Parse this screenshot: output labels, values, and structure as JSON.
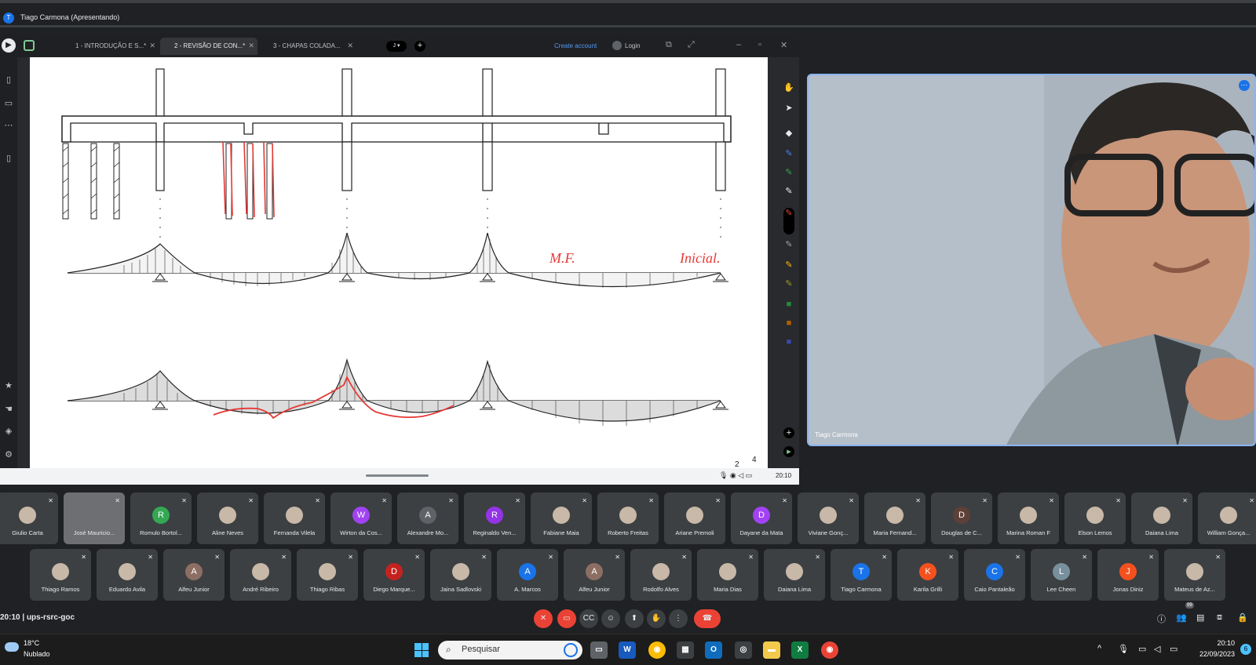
{
  "window": {
    "title": "Tiago Carmona (Apresentando)",
    "initial": "T"
  },
  "presentation": {
    "tabs": [
      {
        "label": "1 - INTRODUÇÃO E S...*",
        "active": false
      },
      {
        "label": "2 - REVISÃO DE CON...*",
        "active": true
      },
      {
        "label": "3 - CHAPAS COLADA...",
        "active": false
      }
    ],
    "pill_label": "J",
    "create_account": "Create account",
    "login": "Login",
    "slide": {
      "annotation_mf": "M.F.",
      "annotation_inicial": "Inicial."
    },
    "page_current": "2",
    "page_total": "4",
    "small_time": "20:10"
  },
  "speaker": {
    "name": "Tiago Carmona"
  },
  "participants_row1": [
    {
      "name": "Giulio Carta",
      "initial": "",
      "color": "#5f6368",
      "photo": true
    },
    {
      "name": "José Mauricio...",
      "initial": "",
      "color": "#5f6368",
      "video": true
    },
    {
      "name": "Romulo Bortol...",
      "initial": "R",
      "color": "#34a853"
    },
    {
      "name": "Aline Neves",
      "initial": "",
      "color": "#c58af9",
      "photo": true
    },
    {
      "name": "Fernanda Vilela",
      "initial": "",
      "color": "#5f6368",
      "photo": true
    },
    {
      "name": "Wirton da Cos...",
      "initial": "W",
      "color": "#a142f4"
    },
    {
      "name": "Alexandre Mo...",
      "initial": "A",
      "color": "#5f6368"
    },
    {
      "name": "Reginaldo Ven...",
      "initial": "R",
      "color": "#9334e6"
    },
    {
      "name": "Fabiane Maia",
      "initial": "",
      "color": "#5f6368",
      "photo": true
    },
    {
      "name": "Roberto Freitas",
      "initial": "",
      "color": "#5f6368",
      "photo": true
    },
    {
      "name": "Ariane Premoli",
      "initial": "",
      "color": "#5f6368",
      "photo": true
    },
    {
      "name": "Dayane da Mata",
      "initial": "D",
      "color": "#a142f4"
    },
    {
      "name": "Viviane Gonç...",
      "initial": "",
      "color": "#5f6368",
      "photo": true
    },
    {
      "name": "Maria Fernand...",
      "initial": "",
      "color": "#5f6368",
      "photo": true
    },
    {
      "name": "Douglas de C...",
      "initial": "D",
      "color": "#5d4037"
    },
    {
      "name": "Marina Roman F",
      "initial": "",
      "color": "#5f6368",
      "photo": true
    },
    {
      "name": "Elson Lemos",
      "initial": "",
      "color": "#5f6368",
      "photo": true
    },
    {
      "name": "Daiana Lima",
      "initial": "",
      "color": "#5f6368",
      "photo": true
    },
    {
      "name": "William Gonça...",
      "initial": "",
      "color": "#5f6368",
      "photo": true
    }
  ],
  "participants_row2": [
    {
      "name": "Thiago Ramos",
      "initial": "",
      "color": "#5f6368",
      "photo": true
    },
    {
      "name": "Eduardo Avila",
      "initial": "",
      "color": "#5f6368",
      "photo": true
    },
    {
      "name": "Alfeu Junior",
      "initial": "A",
      "color": "#8d6e63"
    },
    {
      "name": "André Ribeiro",
      "initial": "",
      "color": "#5f6368",
      "photo": true
    },
    {
      "name": "Thiago Ribas",
      "initial": "",
      "color": "#5f6368",
      "photo": true
    },
    {
      "name": "Diego Marque...",
      "initial": "D",
      "color": "#c5221f"
    },
    {
      "name": "Jaina Sadlovski",
      "initial": "",
      "color": "#5f6368",
      "photo": true
    },
    {
      "name": "A. Marcos",
      "initial": "A",
      "color": "#1a73e8"
    },
    {
      "name": "Alfeu Junior",
      "initial": "A",
      "color": "#8d6e63"
    },
    {
      "name": "Rodolfo Alves",
      "initial": "",
      "color": "#5f6368",
      "photo": true
    },
    {
      "name": "Maria Dias",
      "initial": "",
      "color": "#5f6368",
      "photo": true
    },
    {
      "name": "Daiana Lima",
      "initial": "",
      "color": "#5f6368",
      "photo": true
    },
    {
      "name": "Tiago Carmona",
      "initial": "T",
      "color": "#1a73e8"
    },
    {
      "name": "Karila Grilli",
      "initial": "K",
      "color": "#f4511e"
    },
    {
      "name": "Caio Pantaleão",
      "initial": "C",
      "color": "#1a73e8"
    },
    {
      "name": "Lee Cheen",
      "initial": "L",
      "color": "#78909c"
    },
    {
      "name": "Jonas Diniz",
      "initial": "J",
      "color": "#f4511e"
    },
    {
      "name": "Mateus de Az...",
      "initial": "",
      "color": "#5f6368",
      "photo": true
    }
  ],
  "meeting": {
    "time": "20:10",
    "separator": "|",
    "code": "ups-rsrc-goc",
    "participant_count": "99"
  },
  "taskbar": {
    "temperature": "18°C",
    "condition": "Nublado",
    "search_placeholder": "Pesquisar",
    "clock": "20:10",
    "date": "22/09/2023",
    "notification_count": "6"
  }
}
